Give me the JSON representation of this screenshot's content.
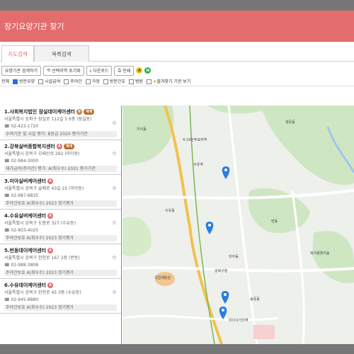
{
  "window": {
    "title": "장기요양기관 찾기"
  },
  "tabs": [
    {
      "label": "지도검색"
    },
    {
      "label": "목록검색"
    }
  ],
  "toolbar": {
    "facility_search": "요양기관 검색하기",
    "reset": "선택지역 초기화",
    "download": "다운로드",
    "print": "인쇄",
    "icon_a": "A",
    "icon_n": "N"
  },
  "filters": {
    "all": "전체",
    "checked": "방문요양",
    "opt2": "시설급여",
    "opt3": "주야간",
    "opt4": "가정",
    "opt5": "방문간호",
    "opt6": "병원",
    "opt7": "즐겨찾기 기관 보기"
  },
  "facilities": [
    {
      "title": "1.사회복지법인 잠실데이케어센터",
      "badge": "B",
      "pill": "재개",
      "addr": "서울특별시 송파구 잠실로 112길 5 6층 (잠실동)",
      "phone": "☎ 02-423-1720",
      "grade": "수여기관 및 시설 평가: B등급 2020 평가기관"
    },
    {
      "title": "2.강북실버종합복지센터",
      "badge": "A",
      "pill": "재개",
      "addr": "서울특별시 강북구 오패산로 292 (미아동)",
      "phone": "☎ 02-984-3000",
      "grade": "재가급여(주야간) 평가: A(최우수) 2021 평가기관"
    },
    {
      "title": "3.미아실버케어센터",
      "badge": "A",
      "pill": "",
      "addr": "서울특별시 강북구 솔매로 43길 25 (미아동)",
      "phone": "☎ 02-987-8835",
      "grade": "주야간보호 A(최우수) 2023 정기평가"
    },
    {
      "title": "4.수유실버케어센터",
      "badge": "A",
      "pill": "",
      "addr": "서울특별시 강북구 도봉로 327 (수유동)",
      "phone": "☎ 02-903-4020",
      "grade": "주야간보호 A(최우수) 2023 정기평가"
    },
    {
      "title": "5.번동데이케어센터",
      "badge": "A",
      "pill": "",
      "addr": "서울특별시 강북구 한천로 167 2층 (번동)",
      "phone": "☎ 02-988-3808",
      "grade": "주야간보호 A(최우수) 2023 정기평가"
    },
    {
      "title": "6.수유데이케어센터",
      "badge": "A",
      "pill": "",
      "addr": "서울특별시 강북구 한천로 45 3층 (수유동)",
      "phone": "☎ 02-945-8880",
      "grade": "주야간보호 A(최우수) 2023 정기평가"
    }
  ],
  "map": {
    "labels": [
      {
        "text": "수유동"
      },
      {
        "text": "미아동"
      },
      {
        "text": "번동"
      },
      {
        "text": "강북구청"
      },
      {
        "text": "수유역"
      },
      {
        "text": "미아사거리역"
      },
      {
        "text": "4.19민주묘지역"
      },
      {
        "text": "우이동"
      },
      {
        "text": "쌍문동"
      },
      {
        "text": "국립재활원"
      },
      {
        "text": "송중동"
      },
      {
        "text": "북서울꿈의숲"
      }
    ]
  }
}
